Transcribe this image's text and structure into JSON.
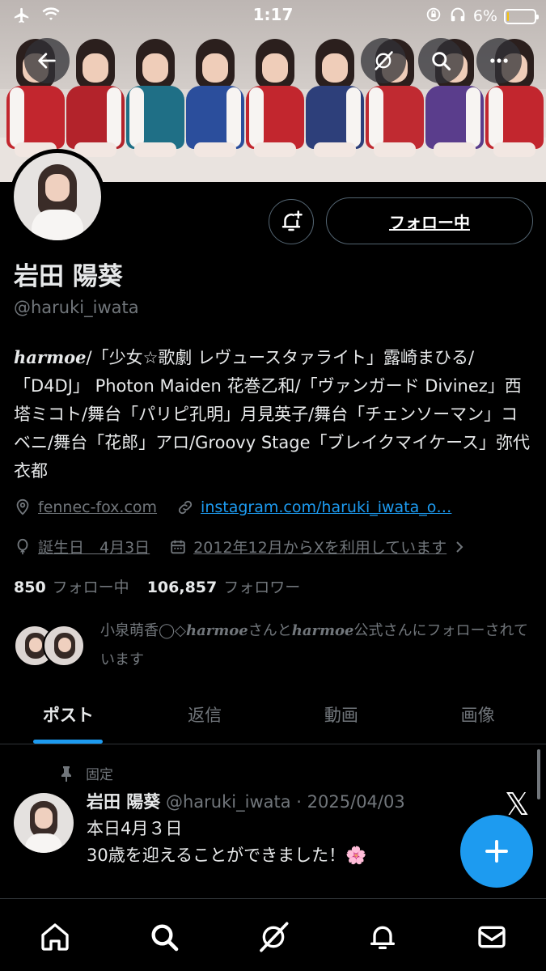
{
  "status_bar": {
    "time": "1:17",
    "battery_pct": "6%",
    "battery_level": 0.06
  },
  "profile": {
    "name": "岩田 陽葵",
    "handle": "@haruki_iwata",
    "follow_button_label": "フォロー中",
    "bio": {
      "brand": "harmoe",
      "text": "/「少女☆歌劇 レヴュースタァライト」露崎まひる/「D4DJ」 Photon Maiden 花巻乙和/「ヴァンガード Divinez」西塔ミコト/舞台「パリピ孔明」月見英子/舞台「チェンソーマン」コベニ/舞台「花郎」アロ/Groovy Stage「ブレイクマイケース」弥代衣都"
    },
    "location": "fennec-fox.com",
    "website": "instagram.com/haruki_iwata_o…",
    "birthday": "誕生日　4月3日",
    "joined": "2012年12月からXを利用しています",
    "following_count": "850",
    "following_label": "フォロー中",
    "followers_count": "106,857",
    "followers_label": "フォロワー",
    "followed_by": {
      "prefix": "小泉萌香◯◇",
      "brand1": "harmoe",
      "middle": "さんと",
      "brand2": "harmoe",
      "suffix": "公式さんにフォローされています"
    }
  },
  "tabs": [
    {
      "label": "ポスト",
      "active": true
    },
    {
      "label": "返信",
      "active": false
    },
    {
      "label": "動画",
      "active": false
    },
    {
      "label": "画像",
      "active": false
    }
  ],
  "pinned_tweet": {
    "pinned_label": "固定",
    "author_name": "岩田 陽葵",
    "author_handle": "@haruki_iwata",
    "separator": "·",
    "date": "2025/04/03",
    "line1": "本日4月３日",
    "line2": "30歳を迎えることができました！🌸"
  },
  "x_logo": "𝕏",
  "colors": {
    "accent": "#1d9bf0",
    "background": "#000000",
    "secondary_text": "#71767b",
    "border": "#2f3336"
  }
}
